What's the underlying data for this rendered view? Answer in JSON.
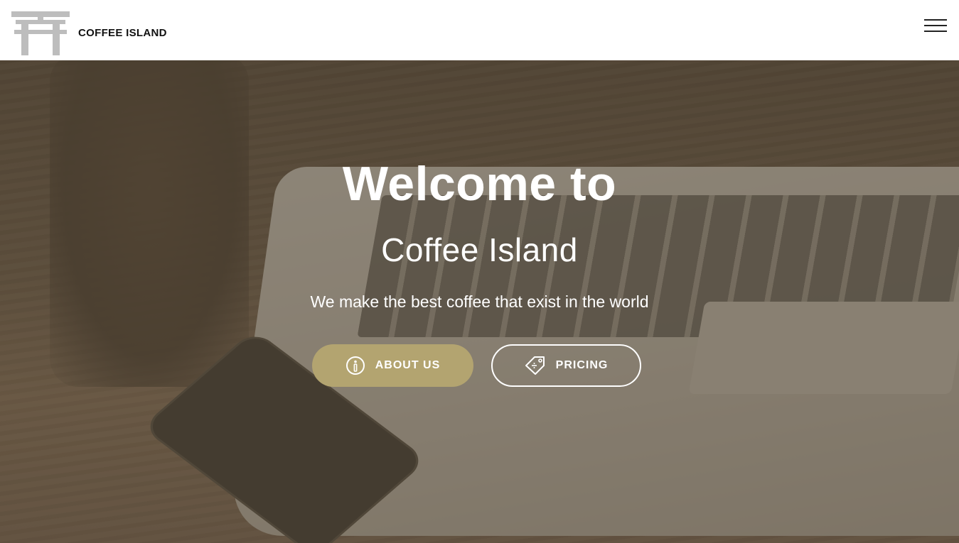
{
  "header": {
    "brand": "COFFEE ISLAND",
    "logo_icon": "torii-gate-icon",
    "menu_icon": "hamburger-menu-icon"
  },
  "hero": {
    "title": "Welcome to",
    "subtitle": "Coffee Island",
    "tagline": "We make the best coffee that exist in the world",
    "buttons": [
      {
        "label": "ABOUT US",
        "icon": "info-icon"
      },
      {
        "label": "PRICING",
        "icon": "price-tag-icon"
      }
    ]
  },
  "colors": {
    "accent": "#b3a470",
    "overlay": "#5e5241",
    "header_bg": "#ffffff"
  }
}
